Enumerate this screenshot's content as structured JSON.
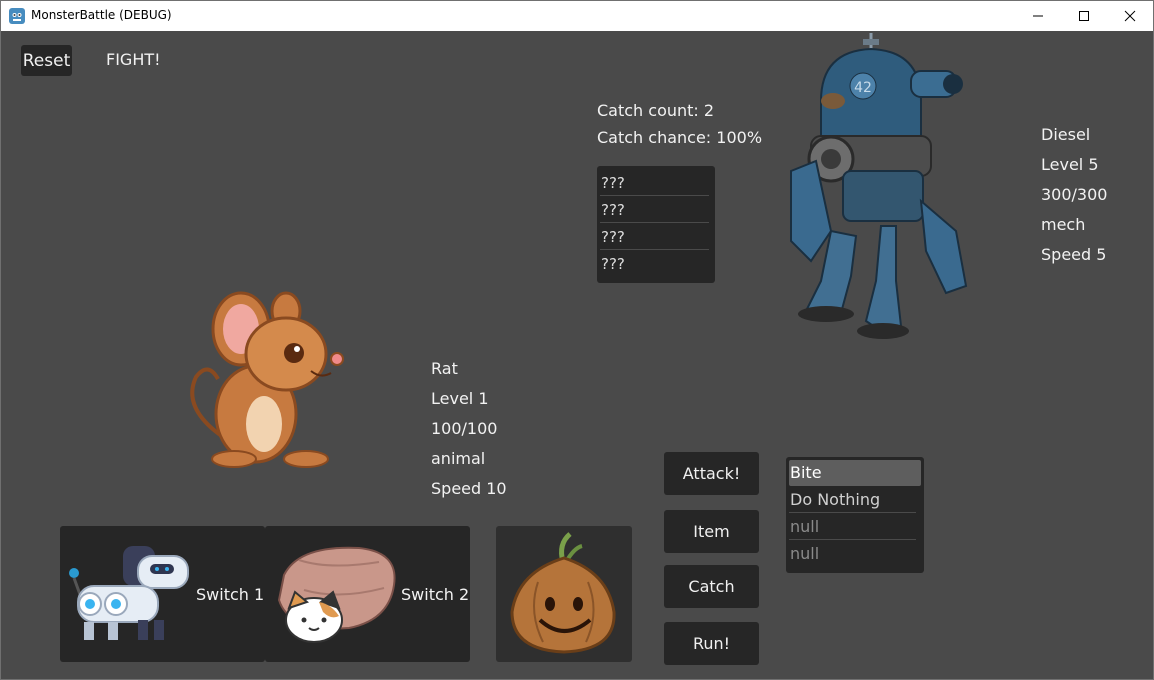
{
  "window": {
    "title": "MonsterBattle (DEBUG)"
  },
  "toolbar": {
    "reset_label": "Reset",
    "fight_label": "FIGHT!"
  },
  "catch_info": {
    "count": "Catch count: 2",
    "chance": "Catch chance: 100%"
  },
  "catch_list": [
    "???",
    "???",
    "???",
    "???"
  ],
  "enemy": {
    "name": "Diesel",
    "level": "Level 5",
    "hp": "300/300",
    "type": "mech",
    "speed": "Speed 5"
  },
  "player": {
    "name": "Rat",
    "level": "Level 1",
    "hp": "100/100",
    "type": "animal",
    "speed": "Speed 10"
  },
  "actions": {
    "attack": "Attack!",
    "item": "Item",
    "catch": "Catch",
    "run": "Run!"
  },
  "moves": [
    {
      "label": "Bite",
      "state": "selected"
    },
    {
      "label": "Do Nothing",
      "state": "enabled"
    },
    {
      "label": "null",
      "state": "disabled"
    },
    {
      "label": "null",
      "state": "disabled"
    }
  ],
  "party": {
    "switch1": "Switch 1",
    "switch2": "Switch 2"
  },
  "colors": {
    "background": "#4a4a4a",
    "panel": "#262626",
    "selected": "#5e5e5e",
    "text": "#f2f2f2",
    "disabled_text": "#8a8a8a"
  }
}
